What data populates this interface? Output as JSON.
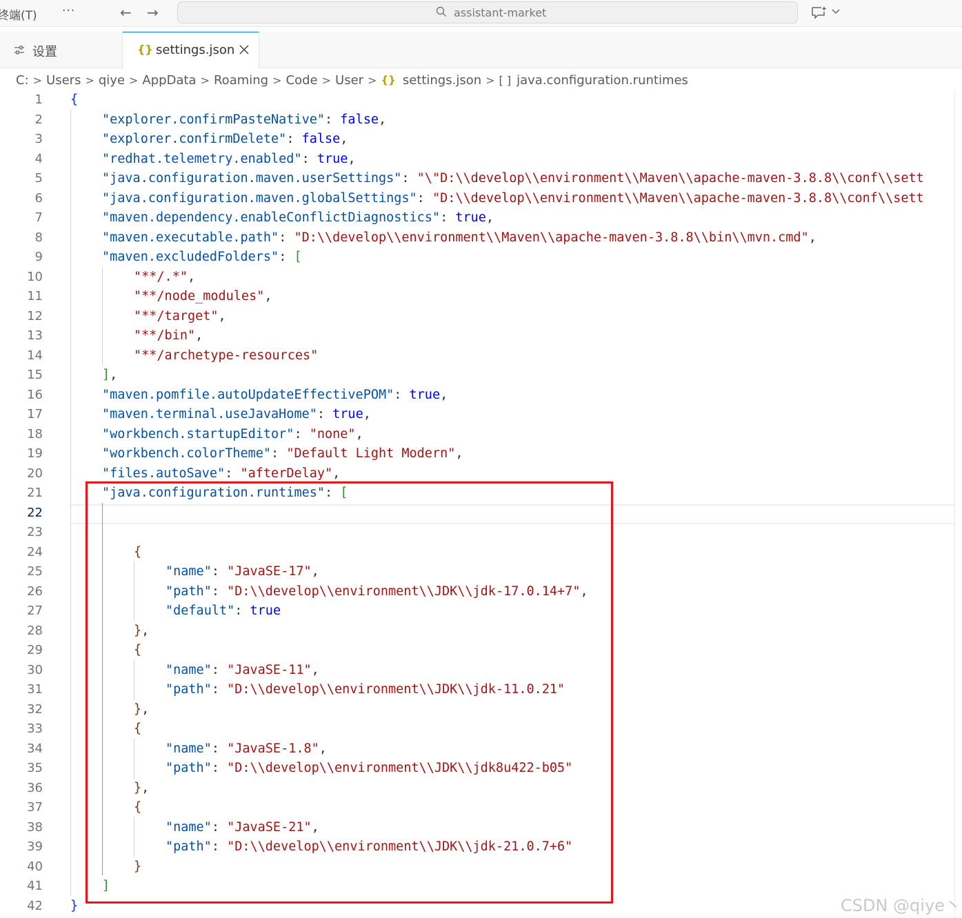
{
  "titlebar": {
    "menu_terminal": "终端(T)",
    "more": "···",
    "back": "←",
    "forward": "→",
    "search_text": "assistant-market"
  },
  "tabs": {
    "settings_label": "设置",
    "json_braces": "{}",
    "json_label": "settings.json"
  },
  "breadcrumb": {
    "items": [
      "C:",
      "Users",
      "qiye",
      "AppData",
      "Roaming",
      "Code",
      "User"
    ],
    "file_braces": "{}",
    "file": "settings.json",
    "symbol_icon": "[ ]",
    "symbol": "java.configuration.runtimes"
  },
  "editor": {
    "current_line": 22,
    "lines": [
      {
        "n": 1,
        "indent": 0,
        "tokens": [
          [
            "brace",
            "{"
          ]
        ]
      },
      {
        "n": 2,
        "indent": 1,
        "tokens": [
          [
            "key",
            "\"explorer.confirmPasteNative\""
          ],
          [
            "punct",
            ": "
          ],
          [
            "bool",
            "false"
          ],
          [
            "punct",
            ","
          ]
        ]
      },
      {
        "n": 3,
        "indent": 1,
        "tokens": [
          [
            "key",
            "\"explorer.confirmDelete\""
          ],
          [
            "punct",
            ": "
          ],
          [
            "bool",
            "false"
          ],
          [
            "punct",
            ","
          ]
        ]
      },
      {
        "n": 4,
        "indent": 1,
        "tokens": [
          [
            "key",
            "\"redhat.telemetry.enabled\""
          ],
          [
            "punct",
            ": "
          ],
          [
            "bool",
            "true"
          ],
          [
            "punct",
            ","
          ]
        ]
      },
      {
        "n": 5,
        "indent": 1,
        "tokens": [
          [
            "key",
            "\"java.configuration.maven.userSettings\""
          ],
          [
            "punct",
            ": "
          ],
          [
            "str",
            "\"\\\"D:\\\\develop\\\\environment\\\\Maven\\\\apache-maven-3.8.8\\\\conf\\\\sett"
          ]
        ]
      },
      {
        "n": 6,
        "indent": 1,
        "tokens": [
          [
            "key",
            "\"java.configuration.maven.globalSettings\""
          ],
          [
            "punct",
            ": "
          ],
          [
            "str",
            "\"D:\\\\develop\\\\environment\\\\Maven\\\\apache-maven-3.8.8\\\\conf\\\\sett"
          ]
        ]
      },
      {
        "n": 7,
        "indent": 1,
        "tokens": [
          [
            "key",
            "\"maven.dependency.enableConflictDiagnostics\""
          ],
          [
            "punct",
            ": "
          ],
          [
            "bool",
            "true"
          ],
          [
            "punct",
            ","
          ]
        ]
      },
      {
        "n": 8,
        "indent": 1,
        "tokens": [
          [
            "key",
            "\"maven.executable.path\""
          ],
          [
            "punct",
            ": "
          ],
          [
            "str",
            "\"D:\\\\develop\\\\environment\\\\Maven\\\\apache-maven-3.8.8\\\\bin\\\\mvn.cmd\""
          ],
          [
            "punct",
            ","
          ]
        ]
      },
      {
        "n": 9,
        "indent": 1,
        "tokens": [
          [
            "key",
            "\"maven.excludedFolders\""
          ],
          [
            "punct",
            ": "
          ],
          [
            "bracket",
            "["
          ]
        ]
      },
      {
        "n": 10,
        "indent": 2,
        "tokens": [
          [
            "str",
            "\"**/.*\""
          ],
          [
            "punct",
            ","
          ]
        ]
      },
      {
        "n": 11,
        "indent": 2,
        "tokens": [
          [
            "str",
            "\"**/node_modules\""
          ],
          [
            "punct",
            ","
          ]
        ]
      },
      {
        "n": 12,
        "indent": 2,
        "tokens": [
          [
            "str",
            "\"**/target\""
          ],
          [
            "punct",
            ","
          ]
        ]
      },
      {
        "n": 13,
        "indent": 2,
        "tokens": [
          [
            "str",
            "\"**/bin\""
          ],
          [
            "punct",
            ","
          ]
        ]
      },
      {
        "n": 14,
        "indent": 2,
        "tokens": [
          [
            "str",
            "\"**/archetype-resources\""
          ]
        ]
      },
      {
        "n": 15,
        "indent": 1,
        "tokens": [
          [
            "bracket",
            "]"
          ],
          [
            "punct",
            ","
          ]
        ]
      },
      {
        "n": 16,
        "indent": 1,
        "tokens": [
          [
            "key",
            "\"maven.pomfile.autoUpdateEffectivePOM\""
          ],
          [
            "punct",
            ": "
          ],
          [
            "bool",
            "true"
          ],
          [
            "punct",
            ","
          ]
        ]
      },
      {
        "n": 17,
        "indent": 1,
        "tokens": [
          [
            "key",
            "\"maven.terminal.useJavaHome\""
          ],
          [
            "punct",
            ": "
          ],
          [
            "bool",
            "true"
          ],
          [
            "punct",
            ","
          ]
        ]
      },
      {
        "n": 18,
        "indent": 1,
        "tokens": [
          [
            "key",
            "\"workbench.startupEditor\""
          ],
          [
            "punct",
            ": "
          ],
          [
            "str",
            "\"none\""
          ],
          [
            "punct",
            ","
          ]
        ]
      },
      {
        "n": 19,
        "indent": 1,
        "tokens": [
          [
            "key",
            "\"workbench.colorTheme\""
          ],
          [
            "punct",
            ": "
          ],
          [
            "str",
            "\"Default Light Modern\""
          ],
          [
            "punct",
            ","
          ]
        ]
      },
      {
        "n": 20,
        "indent": 1,
        "tokens": [
          [
            "key",
            "\"files.autoSave\""
          ],
          [
            "punct",
            ": "
          ],
          [
            "str",
            "\"afterDelay\""
          ],
          [
            "punct",
            ","
          ]
        ]
      },
      {
        "n": 21,
        "indent": 1,
        "tokens": [
          [
            "key",
            "\"java.configuration.runtimes\""
          ],
          [
            "punct",
            ": "
          ],
          [
            "bracket",
            "["
          ]
        ]
      },
      {
        "n": 22,
        "indent": 0,
        "tokens": []
      },
      {
        "n": 23,
        "indent": 0,
        "tokens": []
      },
      {
        "n": 24,
        "indent": 2,
        "tokens": [
          [
            "brace2",
            "{"
          ]
        ]
      },
      {
        "n": 25,
        "indent": 3,
        "tokens": [
          [
            "key",
            "\"name\""
          ],
          [
            "punct",
            ": "
          ],
          [
            "str",
            "\"JavaSE-17\""
          ],
          [
            "punct",
            ","
          ]
        ]
      },
      {
        "n": 26,
        "indent": 3,
        "tokens": [
          [
            "key",
            "\"path\""
          ],
          [
            "punct",
            ": "
          ],
          [
            "str",
            "\"D:\\\\develop\\\\environment\\\\JDK\\\\jdk-17.0.14+7\""
          ],
          [
            "punct",
            ","
          ]
        ]
      },
      {
        "n": 27,
        "indent": 3,
        "tokens": [
          [
            "key",
            "\"default\""
          ],
          [
            "punct",
            ": "
          ],
          [
            "bool",
            "true"
          ]
        ]
      },
      {
        "n": 28,
        "indent": 2,
        "tokens": [
          [
            "brace2",
            "}"
          ],
          [
            "punct",
            ","
          ]
        ]
      },
      {
        "n": 29,
        "indent": 2,
        "tokens": [
          [
            "brace2",
            "{"
          ]
        ]
      },
      {
        "n": 30,
        "indent": 3,
        "tokens": [
          [
            "key",
            "\"name\""
          ],
          [
            "punct",
            ": "
          ],
          [
            "str",
            "\"JavaSE-11\""
          ],
          [
            "punct",
            ","
          ]
        ]
      },
      {
        "n": 31,
        "indent": 3,
        "tokens": [
          [
            "key",
            "\"path\""
          ],
          [
            "punct",
            ": "
          ],
          [
            "str",
            "\"D:\\\\develop\\\\environment\\\\JDK\\\\jdk-11.0.21\""
          ]
        ]
      },
      {
        "n": 32,
        "indent": 2,
        "tokens": [
          [
            "brace2",
            "}"
          ],
          [
            "punct",
            ","
          ]
        ]
      },
      {
        "n": 33,
        "indent": 2,
        "tokens": [
          [
            "brace2",
            "{"
          ]
        ]
      },
      {
        "n": 34,
        "indent": 3,
        "tokens": [
          [
            "key",
            "\"name\""
          ],
          [
            "punct",
            ": "
          ],
          [
            "str",
            "\"JavaSE-1.8\""
          ],
          [
            "punct",
            ","
          ]
        ]
      },
      {
        "n": 35,
        "indent": 3,
        "tokens": [
          [
            "key",
            "\"path\""
          ],
          [
            "punct",
            ": "
          ],
          [
            "str",
            "\"D:\\\\develop\\\\environment\\\\JDK\\\\jdk8u422-b05\""
          ]
        ]
      },
      {
        "n": 36,
        "indent": 2,
        "tokens": [
          [
            "brace2",
            "}"
          ],
          [
            "punct",
            ","
          ]
        ]
      },
      {
        "n": 37,
        "indent": 2,
        "tokens": [
          [
            "brace2",
            "{"
          ]
        ]
      },
      {
        "n": 38,
        "indent": 3,
        "tokens": [
          [
            "key",
            "\"name\""
          ],
          [
            "punct",
            ": "
          ],
          [
            "str",
            "\"JavaSE-21\""
          ],
          [
            "punct",
            ","
          ]
        ]
      },
      {
        "n": 39,
        "indent": 3,
        "tokens": [
          [
            "key",
            "\"path\""
          ],
          [
            "punct",
            ": "
          ],
          [
            "str",
            "\"D:\\\\develop\\\\environment\\\\JDK\\\\jdk-21.0.7+6\""
          ]
        ]
      },
      {
        "n": 40,
        "indent": 2,
        "tokens": [
          [
            "brace2",
            "}"
          ]
        ]
      },
      {
        "n": 41,
        "indent": 1,
        "tokens": [
          [
            "bracket",
            "]"
          ]
        ]
      },
      {
        "n": 42,
        "indent": 0,
        "tokens": [
          [
            "brace",
            "}"
          ]
        ]
      }
    ]
  },
  "annotation": {
    "color": "#e8121a"
  },
  "watermark": "CSDN @qiye丶",
  "colors": {
    "key": "#0451a5",
    "string": "#a31515",
    "keyword": "#0000ff",
    "accent": "#0078d4"
  }
}
